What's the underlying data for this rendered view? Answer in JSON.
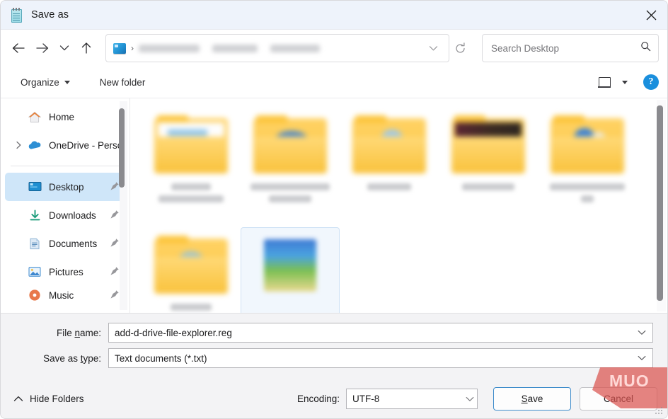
{
  "window": {
    "title": "Save as",
    "title_icon": "notepad-icon",
    "close_icon": "close-icon"
  },
  "nav": {
    "back_icon": "arrow-left-icon",
    "forward_icon": "arrow-right-icon",
    "recent_icon": "chevron-down-icon",
    "up_icon": "arrow-up-icon",
    "address": {
      "root_icon": "desktop-icon",
      "separator": "›",
      "crumbs_redacted": 3,
      "dropdown_icon": "chevron-down-icon",
      "refresh_icon": "refresh-icon"
    },
    "search": {
      "placeholder": "Search Desktop",
      "value": "",
      "icon": "search-icon"
    }
  },
  "toolbar": {
    "organize_label": "Organize",
    "organize_caret_icon": "caret-down-icon",
    "new_folder_label": "New folder",
    "view_icon": "view-layout-icon",
    "view_caret_icon": "caret-down-icon",
    "help_label": "?",
    "help_icon": "help-circle-icon"
  },
  "sidebar": {
    "items": [
      {
        "label": "Home",
        "icon": "home-icon",
        "pinned": false,
        "expandable": false,
        "selected": false
      },
      {
        "label": "OneDrive - Perso",
        "icon": "onedrive-cloud-icon",
        "pinned": false,
        "expandable": true,
        "selected": false
      },
      {
        "label": "Desktop",
        "icon": "desktop-monitor-icon",
        "pinned": true,
        "expandable": false,
        "selected": true
      },
      {
        "label": "Downloads",
        "icon": "download-arrow-icon",
        "pinned": true,
        "expandable": false,
        "selected": false
      },
      {
        "label": "Documents",
        "icon": "document-icon",
        "pinned": true,
        "expandable": false,
        "selected": false
      },
      {
        "label": "Pictures",
        "icon": "picture-icon",
        "pinned": true,
        "expandable": false,
        "selected": false
      },
      {
        "label": "Music",
        "icon": "music-icon",
        "pinned": true,
        "expandable": false,
        "selected": false
      }
    ],
    "scrollbar_icon": "vertical-scrollbar"
  },
  "file_list": {
    "view": "large-icons",
    "note_redacted": "folder and file names are blurred",
    "items": [
      {
        "type": "folder",
        "thumb": "doc",
        "label": "",
        "selected": false,
        "label_widths": [
          56,
          92
        ]
      },
      {
        "type": "folder",
        "thumb": "cloud",
        "label": "",
        "selected": false,
        "label_widths": [
          112,
          60
        ]
      },
      {
        "type": "folder",
        "thumb": "pic",
        "label": "",
        "selected": false,
        "label_widths": [
          62,
          0
        ]
      },
      {
        "type": "folder",
        "thumb": "dark",
        "label": "",
        "selected": false,
        "label_widths": [
          74,
          0
        ]
      },
      {
        "type": "folder",
        "thumb": "blue",
        "label": "",
        "selected": false,
        "label_widths": [
          106,
          18
        ]
      },
      {
        "type": "folder",
        "thumb": "green",
        "label": "",
        "selected": false,
        "label_widths": [
          58,
          0
        ]
      },
      {
        "type": "file",
        "thumb": "image",
        "label": "",
        "selected": true,
        "label_widths": [
          0,
          0
        ]
      }
    ],
    "scrollbar_icon": "vertical-scrollbar"
  },
  "form": {
    "file_name_label": "File name:",
    "file_name_label_accel": "n",
    "file_name_value": "add-d-drive-file-explorer.reg",
    "save_as_type_label": "Save as type:",
    "save_as_type_label_accel": "t",
    "save_as_type_value": "Text documents (*.txt)",
    "dropdown_icon": "chevron-down-icon"
  },
  "footer": {
    "hide_folders_label": "Hide Folders",
    "hide_folders_icon": "chevron-up-icon",
    "encoding_label": "Encoding:",
    "encoding_value": "UTF-8",
    "encoding_dropdown_icon": "chevron-down-icon",
    "save_label": "Save",
    "save_label_accel": "S",
    "cancel_label": "Cancel",
    "resize_grip_icon": "resize-grip-icon"
  },
  "watermark": {
    "text": "MUO",
    "color": "#d9534f"
  },
  "colors": {
    "titlebar_bg": "#eef3fb",
    "selection_blue": "#cfe6f9",
    "accent_blue": "#1a8fdd",
    "default_button_border": "#3f8ccb",
    "form_bg": "#f3f3f5",
    "folder_yellow": "#fbc63f"
  }
}
